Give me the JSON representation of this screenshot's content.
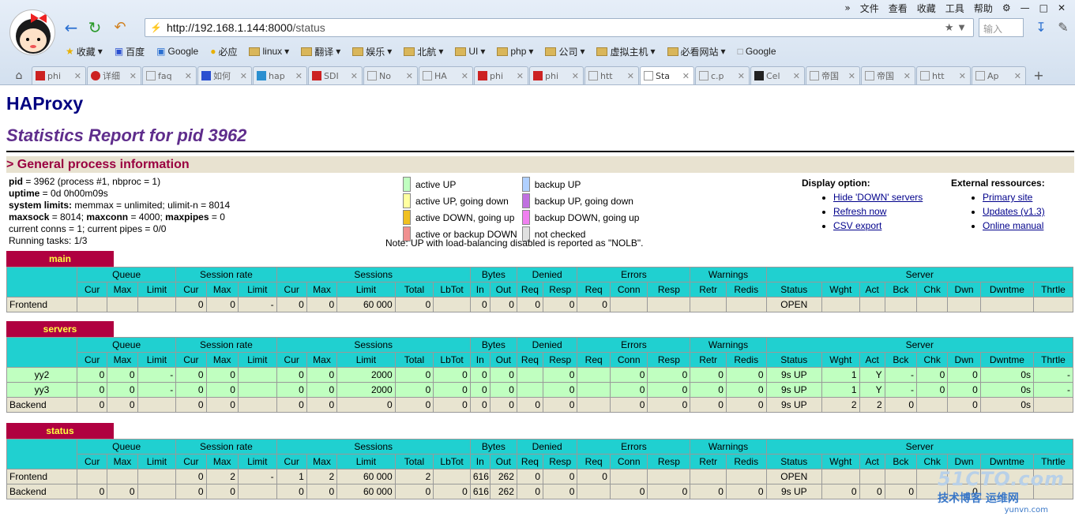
{
  "browser": {
    "menu": [
      "»",
      "文件",
      "查看",
      "收藏",
      "工具",
      "帮助"
    ],
    "url_host": "http://192.168.1.144:8000",
    "url_path": "/status",
    "search_placeholder": "输入",
    "bookmarks": [
      "收藏",
      "百度",
      "Google",
      "必应",
      "linux",
      "翻译",
      "娱乐",
      "北航",
      "UI",
      "php",
      "公司",
      "虚拟主机",
      "必看网站",
      "Google"
    ],
    "tabs": [
      "phi",
      "详细",
      "faq",
      "如何",
      "hap",
      "SDI",
      "No",
      "HA",
      "phi",
      "phi",
      "htt",
      "Sta",
      "c.p",
      "Cel",
      "帝国",
      "帝国",
      "htt",
      "Ap"
    ],
    "active_tab": 11
  },
  "page": {
    "title": "HAProxy",
    "subtitle": "Statistics Report for pid 3962",
    "section": "> General process information",
    "pinfo": {
      "l1k": "pid",
      "l1v": " = 3962 (process #1, nbproc = 1)",
      "l2k": "uptime",
      "l2v": " = 0d 0h00m09s",
      "l3k": "system limits:",
      "l3v": " memmax = unlimited; ulimit-n = 8014",
      "l4k1": "maxsock",
      "l4v1": " = 8014; ",
      "l4k2": "maxconn",
      "l4v2": " = 4000; ",
      "l4k3": "maxpipes",
      "l4v3": " = 0",
      "l5": "current conns = 1; current pipes = 0/0",
      "l6": "Running tasks: 1/3"
    },
    "legend": {
      "a1": "active UP",
      "b1": "backup UP",
      "a2": "active UP, going down",
      "b2": "backup UP, going down",
      "a3": "active DOWN, going up",
      "b3": "backup DOWN, going up",
      "a4": "active or backup DOWN",
      "b4": "not checked",
      "note": "Note: UP with load-balancing disabled is reported as \"NOLB\"."
    },
    "display": {
      "title": "Display option:",
      "hide_down": "Hide 'DOWN' servers",
      "refresh": "Refresh now",
      "csv": "CSV export"
    },
    "external": {
      "title": "External ressources:",
      "primary": "Primary site",
      "updates": "Updates (v1.3)",
      "manual": "Online manual"
    }
  },
  "headers": {
    "groups": [
      "Queue",
      "Session rate",
      "Sessions",
      "Bytes",
      "Denied",
      "Errors",
      "Warnings",
      "Server"
    ],
    "cols": [
      "Cur",
      "Max",
      "Limit",
      "Cur",
      "Max",
      "Limit",
      "Cur",
      "Max",
      "Limit",
      "Total",
      "LbTot",
      "In",
      "Out",
      "Req",
      "Resp",
      "Req",
      "Conn",
      "Resp",
      "Retr",
      "Redis",
      "Status",
      "Wght",
      "Act",
      "Bck",
      "Chk",
      "Dwn",
      "Dwntme",
      "Thrtle"
    ]
  },
  "proxies": [
    {
      "name": "main",
      "rows": [
        {
          "kind": "fe",
          "cells": [
            "Frontend",
            "",
            "",
            "",
            "0",
            "0",
            "-",
            "0",
            "0",
            "60 000",
            "0",
            "",
            "0",
            "0",
            "0",
            "0",
            "0",
            "",
            "",
            "",
            "",
            "OPEN",
            "",
            "",
            "",
            "",
            "",
            "",
            ""
          ]
        }
      ]
    },
    {
      "name": "servers",
      "rows": [
        {
          "kind": "up",
          "cells": [
            "yy2",
            "0",
            "0",
            "-",
            "0",
            "0",
            "",
            "0",
            "0",
            "2000",
            "0",
            "0",
            "0",
            "0",
            "",
            "0",
            "",
            "0",
            "0",
            "0",
            "0",
            "9s UP",
            "1",
            "Y",
            "-",
            "0",
            "0",
            "0s",
            "-"
          ]
        },
        {
          "kind": "up",
          "cells": [
            "yy3",
            "0",
            "0",
            "-",
            "0",
            "0",
            "",
            "0",
            "0",
            "2000",
            "0",
            "0",
            "0",
            "0",
            "",
            "0",
            "",
            "0",
            "0",
            "0",
            "0",
            "9s UP",
            "1",
            "Y",
            "-",
            "0",
            "0",
            "0s",
            "-"
          ]
        },
        {
          "kind": "be",
          "cells": [
            "Backend",
            "0",
            "0",
            "",
            "0",
            "0",
            "",
            "0",
            "0",
            "0",
            "0",
            "0",
            "0",
            "0",
            "0",
            "0",
            "",
            "0",
            "0",
            "0",
            "0",
            "9s UP",
            "2",
            "2",
            "0",
            "",
            "0",
            "0s",
            ""
          ]
        }
      ]
    },
    {
      "name": "status",
      "rows": [
        {
          "kind": "fe",
          "cells": [
            "Frontend",
            "",
            "",
            "",
            "0",
            "2",
            "-",
            "1",
            "2",
            "60 000",
            "2",
            "",
            "616",
            "262",
            "0",
            "0",
            "0",
            "",
            "",
            "",
            "",
            "OPEN",
            "",
            "",
            "",
            "",
            "",
            "",
            ""
          ]
        },
        {
          "kind": "be",
          "cells": [
            "Backend",
            "0",
            "0",
            "",
            "0",
            "0",
            "",
            "0",
            "0",
            "60 000",
            "0",
            "0",
            "616",
            "262",
            "0",
            "0",
            "",
            "0",
            "0",
            "0",
            "0",
            "9s UP",
            "0",
            "0",
            "0",
            "",
            "0",
            "",
            ""
          ]
        }
      ]
    }
  ],
  "watermark": {
    "brand": "51CTO.com",
    "line2": "技术博客 运维网",
    "line3": "yunvn.com"
  },
  "colors": {
    "header_cyan": "#20d0d0",
    "proxy_label": "#b00040",
    "up_green": "#c0ffc0",
    "fe_be": "#e8e4d0",
    "title_blue": "#000080",
    "subtitle_purple": "#5f2d8c",
    "legend_active_up": "#c0ffc0",
    "legend_active_up_going_down": "#ffffa0",
    "legend_active_down_going_up": "#f0c020",
    "legend_active_or_backup_down": "#f09090",
    "legend_backup_up": "#b0d0ff",
    "legend_backup_up_going_down": "#c070e0",
    "legend_backup_down_going_up": "#f080f0",
    "legend_not_checked": "#e0e0e0"
  }
}
